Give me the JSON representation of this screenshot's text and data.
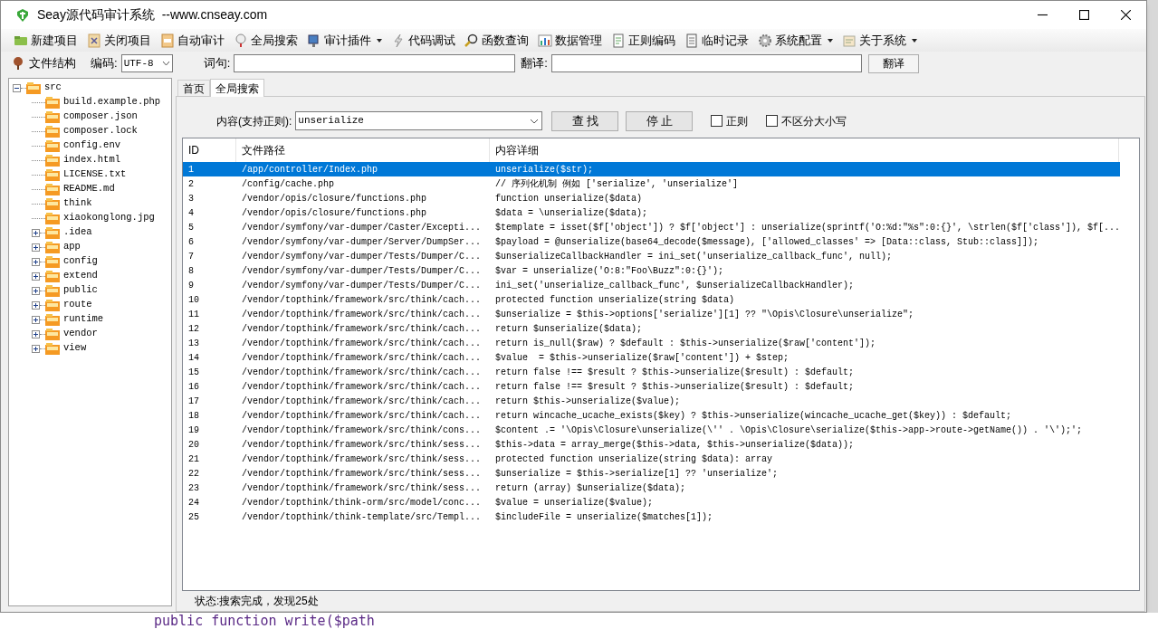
{
  "window": {
    "title": "Seay源代码审计系统  --www.cnseay.com"
  },
  "toolbar": [
    {
      "label": "新建项目",
      "dropdown": false
    },
    {
      "label": "关闭项目",
      "dropdown": false
    },
    {
      "label": "自动审计",
      "dropdown": false
    },
    {
      "label": "全局搜索",
      "dropdown": false
    },
    {
      "label": "审计插件",
      "dropdown": true
    },
    {
      "label": "代码调试",
      "dropdown": false
    },
    {
      "label": "函数查询",
      "dropdown": false
    },
    {
      "label": "数据管理",
      "dropdown": false
    },
    {
      "label": "正则编码",
      "dropdown": false
    },
    {
      "label": "临时记录",
      "dropdown": false
    },
    {
      "label": "系统配置",
      "dropdown": true
    },
    {
      "label": "关于系统",
      "dropdown": true
    }
  ],
  "toolbar2": {
    "file_structure": "文件结构",
    "encoding_label": "编码:",
    "encoding": "UTF-8",
    "phrase_label": "词句:",
    "translate_label": "翻译:",
    "translate_button": "翻译"
  },
  "file_tree": {
    "label": "src",
    "kind": "folder",
    "expanded": true,
    "children": [
      {
        "label": "build.example.php",
        "kind": "file"
      },
      {
        "label": "composer.json",
        "kind": "file"
      },
      {
        "label": "composer.lock",
        "kind": "file"
      },
      {
        "label": "config.env",
        "kind": "file"
      },
      {
        "label": "index.html",
        "kind": "file"
      },
      {
        "label": "LICENSE.txt",
        "kind": "file"
      },
      {
        "label": "README.md",
        "kind": "file"
      },
      {
        "label": "think",
        "kind": "file"
      },
      {
        "label": "xiaokonglong.jpg",
        "kind": "file"
      },
      {
        "label": ".idea",
        "kind": "folder",
        "expanded": false
      },
      {
        "label": "app",
        "kind": "folder",
        "expanded": false
      },
      {
        "label": "config",
        "kind": "folder",
        "expanded": false
      },
      {
        "label": "extend",
        "kind": "folder",
        "expanded": false
      },
      {
        "label": "public",
        "kind": "folder",
        "expanded": false
      },
      {
        "label": "route",
        "kind": "folder",
        "expanded": false
      },
      {
        "label": "runtime",
        "kind": "folder",
        "expanded": false
      },
      {
        "label": "vendor",
        "kind": "folder",
        "expanded": false
      },
      {
        "label": "view",
        "kind": "folder",
        "expanded": false
      }
    ]
  },
  "tabs": [
    {
      "label": "首页",
      "selected": false
    },
    {
      "label": "全局搜索",
      "selected": true
    }
  ],
  "search": {
    "label": "内容(支持正则):",
    "value": "unserialize",
    "find_button": "查 找",
    "stop_button": "停 止",
    "options": [
      {
        "label": "正则",
        "checked": false
      },
      {
        "label": "不区分大小写",
        "checked": false
      }
    ]
  },
  "results": {
    "columns": [
      "ID",
      "文件路径",
      "内容详细"
    ],
    "rows": [
      {
        "id": "1",
        "path": "/app/controller/Index.php",
        "detail": "unserialize($str);",
        "selected": true
      },
      {
        "id": "2",
        "path": "/config/cache.php",
        "detail": "// 序列化机制 例如 ['serialize', 'unserialize']",
        "selected": false
      },
      {
        "id": "3",
        "path": "/vendor/opis/closure/functions.php",
        "detail": "function unserialize($data)",
        "selected": false
      },
      {
        "id": "4",
        "path": "/vendor/opis/closure/functions.php",
        "detail": "$data = \\unserialize($data);",
        "selected": false
      },
      {
        "id": "5",
        "path": "/vendor/symfony/var-dumper/Caster/Excepti...",
        "detail": "$template = isset($f['object']) ? $f['object'] : unserialize(sprintf('O:%d:\"%s\":0:{}', \\strlen($f['class']), $f[...",
        "selected": false
      },
      {
        "id": "6",
        "path": "/vendor/symfony/var-dumper/Server/DumpSer...",
        "detail": "$payload = @unserialize(base64_decode($message), ['allowed_classes' => [Data::class, Stub::class]]);",
        "selected": false
      },
      {
        "id": "7",
        "path": "/vendor/symfony/var-dumper/Tests/Dumper/C...",
        "detail": "$unserializeCallbackHandler = ini_set('unserialize_callback_func', null);",
        "selected": false
      },
      {
        "id": "8",
        "path": "/vendor/symfony/var-dumper/Tests/Dumper/C...",
        "detail": "$var = unserialize('O:8:\"Foo\\Buzz\":0:{}');",
        "selected": false
      },
      {
        "id": "9",
        "path": "/vendor/symfony/var-dumper/Tests/Dumper/C...",
        "detail": "ini_set('unserialize_callback_func', $unserializeCallbackHandler);",
        "selected": false
      },
      {
        "id": "10",
        "path": "/vendor/topthink/framework/src/think/cach...",
        "detail": "protected function unserialize(string $data)",
        "selected": false
      },
      {
        "id": "11",
        "path": "/vendor/topthink/framework/src/think/cach...",
        "detail": "$unserialize = $this->options['serialize'][1] ?? \"\\Opis\\Closure\\unserialize\";",
        "selected": false
      },
      {
        "id": "12",
        "path": "/vendor/topthink/framework/src/think/cach...",
        "detail": "return $unserialize($data);",
        "selected": false
      },
      {
        "id": "13",
        "path": "/vendor/topthink/framework/src/think/cach...",
        "detail": "return is_null($raw) ? $default : $this->unserialize($raw['content']);",
        "selected": false
      },
      {
        "id": "14",
        "path": "/vendor/topthink/framework/src/think/cach...",
        "detail": "$value  = $this->unserialize($raw['content']) + $step;",
        "selected": false
      },
      {
        "id": "15",
        "path": "/vendor/topthink/framework/src/think/cach...",
        "detail": "return false !== $result ? $this->unserialize($result) : $default;",
        "selected": false
      },
      {
        "id": "16",
        "path": "/vendor/topthink/framework/src/think/cach...",
        "detail": "return false !== $result ? $this->unserialize($result) : $default;",
        "selected": false
      },
      {
        "id": "17",
        "path": "/vendor/topthink/framework/src/think/cach...",
        "detail": "return $this->unserialize($value);",
        "selected": false
      },
      {
        "id": "18",
        "path": "/vendor/topthink/framework/src/think/cach...",
        "detail": "return wincache_ucache_exists($key) ? $this->unserialize(wincache_ucache_get($key)) : $default;",
        "selected": false
      },
      {
        "id": "19",
        "path": "/vendor/topthink/framework/src/think/cons...",
        "detail": "$content .= '\\Opis\\Closure\\unserialize(\\'' . \\Opis\\Closure\\serialize($this->app->route->getName()) . '\\');';",
        "selected": false
      },
      {
        "id": "20",
        "path": "/vendor/topthink/framework/src/think/sess...",
        "detail": "$this->data = array_merge($this->data, $this->unserialize($data));",
        "selected": false
      },
      {
        "id": "21",
        "path": "/vendor/topthink/framework/src/think/sess...",
        "detail": "protected function unserialize(string $data): array",
        "selected": false
      },
      {
        "id": "22",
        "path": "/vendor/topthink/framework/src/think/sess...",
        "detail": "$unserialize = $this->serialize[1] ?? 'unserialize';",
        "selected": false
      },
      {
        "id": "23",
        "path": "/vendor/topthink/framework/src/think/sess...",
        "detail": "return (array) $unserialize($data);",
        "selected": false
      },
      {
        "id": "24",
        "path": "/vendor/topthink/think-orm/src/model/conc...",
        "detail": "$value = unserialize($value);",
        "selected": false
      },
      {
        "id": "25",
        "path": "/vendor/topthink/think-template/src/Templ...",
        "detail": "$includeFile = unserialize($matches[1]);",
        "selected": false
      }
    ]
  },
  "status_bar": "状态:搜索完成，发现25处",
  "background": {
    "code_line": "public function write($path"
  }
}
